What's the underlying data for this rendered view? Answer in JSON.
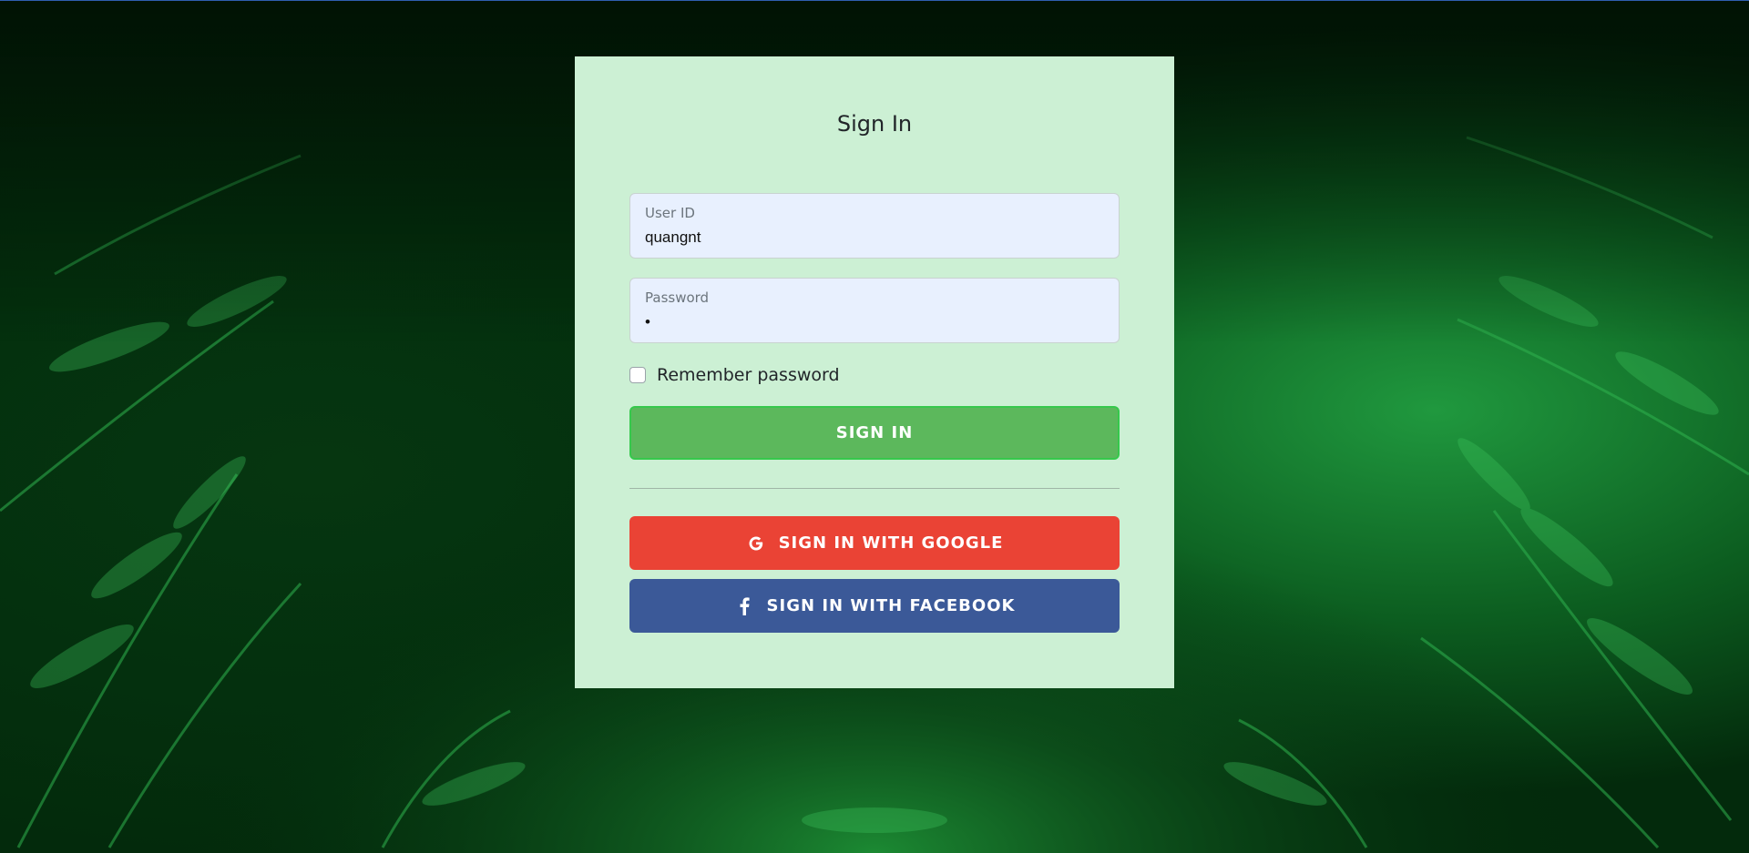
{
  "signin_card": {
    "title": "Sign In",
    "user_id": {
      "label": "User ID",
      "value": "quangnt"
    },
    "password": {
      "label": "Password",
      "value": "•"
    },
    "remember": {
      "label": "Remember password",
      "checked": false
    },
    "signin_button": "SIGN IN",
    "google_button": "SIGN IN WITH GOOGLE",
    "facebook_button": "SIGN IN WITH FACEBOOK"
  },
  "icons": {
    "google": "google-g-icon",
    "facebook": "facebook-f-icon"
  },
  "colors": {
    "card_background": "#ccf0d4",
    "input_background": "#e8f0fe",
    "signin_button": "#5cb85c",
    "google_button": "#ea4335",
    "facebook_button": "#3b5998",
    "background_foliage": "#0f7a26"
  }
}
